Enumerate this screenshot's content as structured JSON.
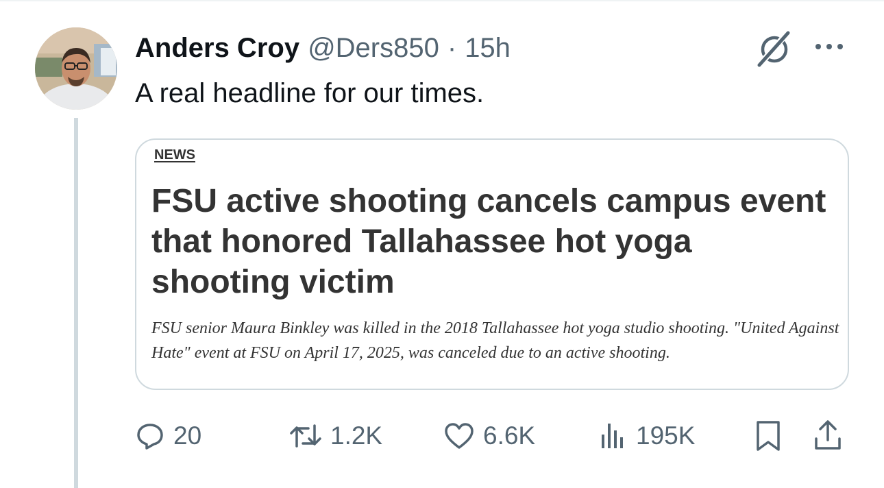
{
  "tweet": {
    "author": {
      "display_name": "Anders Croy",
      "handle": "@Ders850"
    },
    "separator": "·",
    "time": "15h",
    "text": "A real headline for our times."
  },
  "card": {
    "tag": "NEWS",
    "headline": "FSU active shooting cancels campus event that honored Tallahassee hot yoga shooting victim",
    "summary": "FSU senior Maura Binkley was killed in the 2018 Tallahassee hot yoga studio shooting. \"United Against Hate\" event at FSU on April 17, 2025, was canceled due to an active shooting."
  },
  "actions": {
    "replies": "20",
    "reposts": "1.2K",
    "likes": "6.6K",
    "views": "195K"
  },
  "icons": {
    "grok": "grok-icon",
    "more": "more-options-icon",
    "reply": "reply-icon",
    "repost": "repost-icon",
    "like": "heart-icon",
    "views": "views-chart-icon",
    "bookmark": "bookmark-icon",
    "share": "share-icon"
  },
  "colors": {
    "text_primary": "#0f1419",
    "text_secondary": "#536471",
    "border": "#cfd9de",
    "card_text": "#333333"
  }
}
